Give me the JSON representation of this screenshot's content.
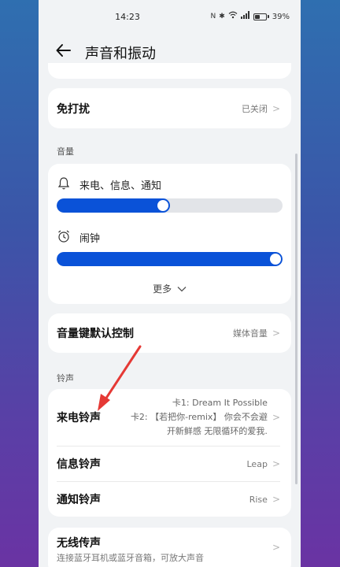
{
  "status_bar": {
    "time": "14:23",
    "battery": "39%",
    "icons": [
      "nfc-icon",
      "bluetooth-icon",
      "wifi-icon",
      "signal-icon",
      "battery-icon"
    ]
  },
  "header": {
    "title": "声音和振动"
  },
  "dnd": {
    "label": "免打扰",
    "value": "已关闭"
  },
  "volume": {
    "section_title": "音量",
    "items": [
      {
        "label": "来电、信息、通知",
        "icon": "bell-icon",
        "level": 0.5
      },
      {
        "label": "闹钟",
        "icon": "alarm-clock-icon",
        "level": 1.0
      }
    ],
    "more": "更多"
  },
  "volume_key": {
    "label": "音量键默认控制",
    "value": "媒体音量"
  },
  "ringtone": {
    "section_title": "铃声",
    "incoming": {
      "label": "来电铃声",
      "line1": "卡1: Dream It Possible",
      "line2": "卡2: 【若把你-remix】 你会不会避",
      "line3": "开新鲜感 无限循环的爱我."
    },
    "message": {
      "label": "信息铃声",
      "value": "Leap"
    },
    "notification": {
      "label": "通知铃声",
      "value": "Rise"
    }
  },
  "wireless": {
    "label": "无线传声",
    "desc": "连接蓝牙耳机或蓝牙音箱，可放大声音"
  },
  "colors": {
    "accent": "#0a52d8",
    "annotation": "#e53935"
  }
}
